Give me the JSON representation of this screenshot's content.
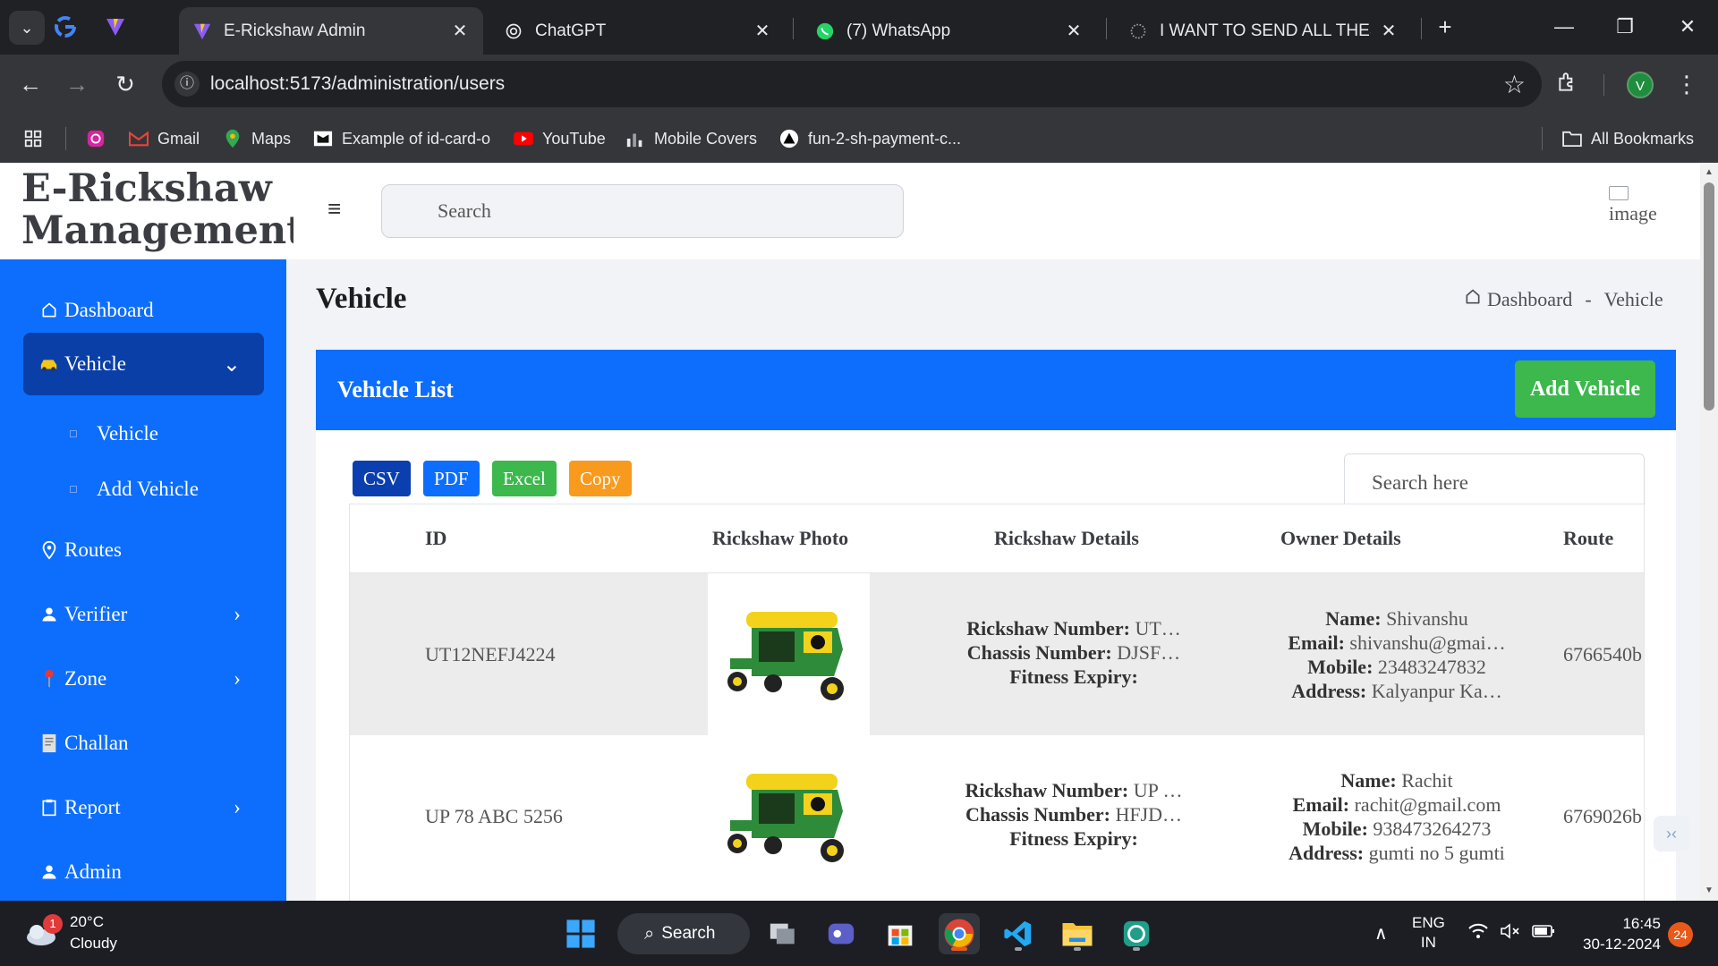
{
  "browser": {
    "tabs": [
      {
        "title": "E-Rickshaw Admin",
        "active": true
      },
      {
        "title": "ChatGPT",
        "active": false
      },
      {
        "title": "(7) WhatsApp",
        "active": false
      },
      {
        "title": "I WANT TO SEND ALL THESE F",
        "active": false
      }
    ],
    "url": "localhost:5173/administration/users",
    "profile_initial": "V",
    "bookmarks": [
      "Gmail",
      "Maps",
      "Example of id-card-o",
      "YouTube",
      "Mobile Covers",
      "fun-2-sh-payment-c..."
    ],
    "all_bookmarks": "All Bookmarks"
  },
  "brand": {
    "line1": "E-Rickshaw",
    "line2": "Management"
  },
  "header": {
    "search_placeholder": "Search",
    "avatar_alt": "image"
  },
  "sidebar": {
    "items": [
      {
        "label": "Dashboard",
        "icon": "home-icon"
      },
      {
        "label": "Vehicle",
        "icon": "taxi-icon",
        "expanded": true
      },
      {
        "label": "Routes",
        "icon": "map-pin-icon"
      },
      {
        "label": "Verifier",
        "icon": "user-icon"
      },
      {
        "label": "Zone",
        "icon": "pushpin-icon"
      },
      {
        "label": "Challan",
        "icon": "receipt-icon"
      },
      {
        "label": "Report",
        "icon": "clipboard-icon"
      },
      {
        "label": "Admin",
        "icon": "user-icon"
      }
    ],
    "vehicle_sub": [
      "Vehicle",
      "Add Vehicle"
    ]
  },
  "page": {
    "title": "Vehicle",
    "breadcrumb": {
      "home": "Dashboard",
      "separator": "-",
      "current": "Vehicle"
    }
  },
  "card": {
    "title": "Vehicle List",
    "add_button": "Add Vehicle",
    "export_buttons": [
      {
        "label": "CSV",
        "color": "#0b3fb0"
      },
      {
        "label": "PDF",
        "color": "#0d6efd"
      },
      {
        "label": "Excel",
        "color": "#3cb84c"
      },
      {
        "label": "Copy",
        "color": "#f79a1e"
      }
    ],
    "search_placeholder": "Search here"
  },
  "table": {
    "columns": [
      "ID",
      "Rickshaw Photo",
      "Rickshaw Details",
      "Owner Details",
      "Route"
    ],
    "labels": {
      "rickshaw_number": "Rickshaw Number:",
      "chassis_number": "Chassis Number:",
      "fitness_expiry": "Fitness Expiry:",
      "name": "Name:",
      "email": "Email:",
      "mobile": "Mobile:",
      "address": "Address:"
    },
    "rows": [
      {
        "id": "UT12NEFJ4224",
        "rickshaw_number": "UT…",
        "chassis_number": "DJSF…",
        "fitness_expiry": "",
        "name": "Shivanshu",
        "email": "shivanshu@gmai…",
        "mobile": "23483247832",
        "address": "Kalyanpur Ka…",
        "route": "6766540b"
      },
      {
        "id": "UP 78 ABC 5256",
        "rickshaw_number": "UP …",
        "chassis_number": "HFJD…",
        "fitness_expiry": "",
        "name": "Rachit",
        "email": "rachit@gmail.com",
        "mobile": "938473264273",
        "address": "gumti no 5 gumti",
        "route": "6769026b"
      }
    ]
  },
  "taskbar": {
    "weather_temp": "20°C",
    "weather_desc": "Cloudy",
    "weather_badge": "1",
    "search_label": "Search",
    "lang_line1": "ENG",
    "lang_line2": "IN",
    "time": "16:45",
    "date": "30-12-2024",
    "notification_count": "24"
  }
}
